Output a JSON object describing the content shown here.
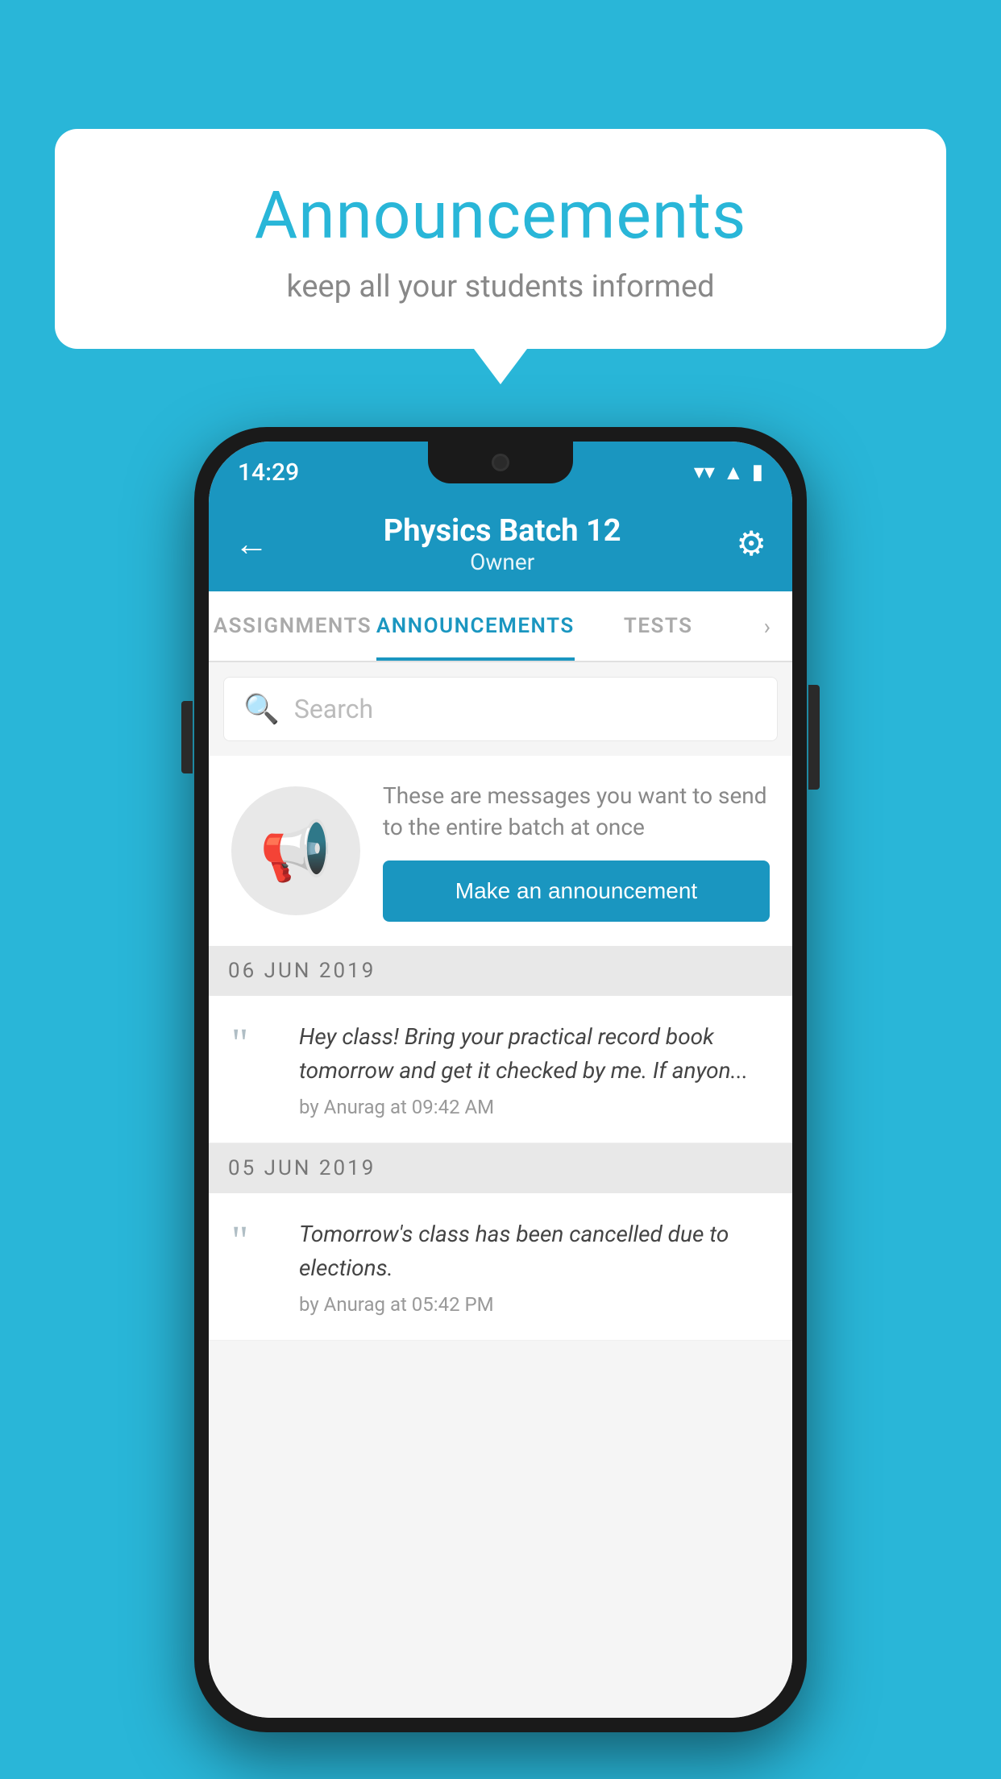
{
  "background_color": "#29b6d8",
  "speech_bubble": {
    "title": "Announcements",
    "subtitle": "keep all your students informed"
  },
  "phone": {
    "status_bar": {
      "time": "14:29"
    },
    "top_nav": {
      "title": "Physics Batch 12",
      "subtitle": "Owner",
      "back_label": "←",
      "gear_label": "⚙"
    },
    "tabs": [
      {
        "label": "ASSIGNMENTS",
        "active": false
      },
      {
        "label": "ANNOUNCEMENTS",
        "active": true
      },
      {
        "label": "TESTS",
        "active": false
      }
    ],
    "search": {
      "placeholder": "Search"
    },
    "promo": {
      "description": "These are messages you want to send to the entire batch at once",
      "button_label": "Make an announcement"
    },
    "announcements": [
      {
        "date": "06  JUN  2019",
        "message": "Hey class! Bring your practical record book tomorrow and get it checked by me. If anyon...",
        "meta": "by Anurag at 09:42 AM"
      },
      {
        "date": "05  JUN  2019",
        "message": "Tomorrow's class has been cancelled due to elections.",
        "meta": "by Anurag at 05:42 PM"
      }
    ]
  }
}
